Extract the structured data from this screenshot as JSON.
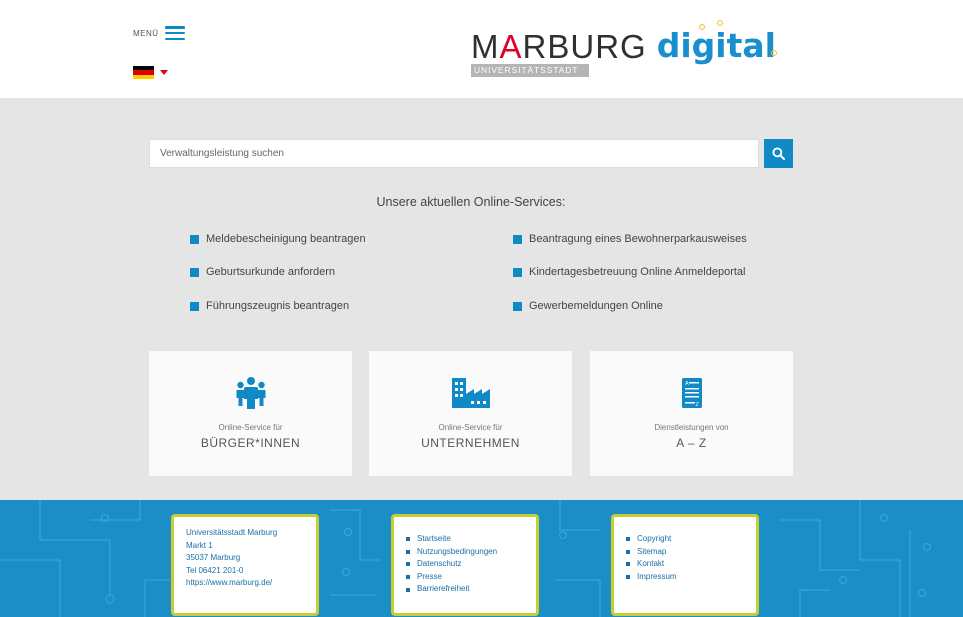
{
  "header": {
    "menu_label": "MENÜ",
    "logo": {
      "word_start": "M",
      "word_accent": "A",
      "word_end": "RBURG",
      "subtitle": "UNIVERSITÄTSSTADT",
      "digital": "digital"
    }
  },
  "search": {
    "placeholder": "Verwaltungsleistung suchen"
  },
  "services": {
    "title": "Unsere aktuellen Online-Services:",
    "left": [
      "Meldebescheinigung beantragen",
      "Geburtsurkunde anfordern",
      "Führungszeugnis beantragen"
    ],
    "right": [
      "Beantragung eines Bewohnerparkausweises",
      "Kindertagesbetreuung Online Anmeldeportal",
      "Gewerbemeldungen Online"
    ]
  },
  "cards": [
    {
      "icon": "people-icon",
      "small": "Online-Service für",
      "big": "BÜRGER*INNEN"
    },
    {
      "icon": "factory-icon",
      "small": "Online-Service für",
      "big": "UNTERNEHMEN"
    },
    {
      "icon": "document-list-icon",
      "small": "Dienstleistungen von",
      "big": "A – Z"
    }
  ],
  "footer": {
    "address": [
      "Universitätsstadt Marburg",
      "Markt 1",
      "35037 Marburg",
      "Tel 06421 201-0",
      "https://www.marburg.de/"
    ],
    "links_mid": [
      "Startseite",
      "Nutzungsbedingungen",
      "Datenschutz",
      "Presse",
      "Barrierefreiheit"
    ],
    "links_right": [
      "Copyright",
      "Sitemap",
      "Kontakt",
      "Impressum"
    ]
  },
  "colors": {
    "accent_blue": "#0f8ac7",
    "footer_blue": "#1b8ec7",
    "footer_box_border": "#c7cd32",
    "logo_red": "#e0002a"
  }
}
